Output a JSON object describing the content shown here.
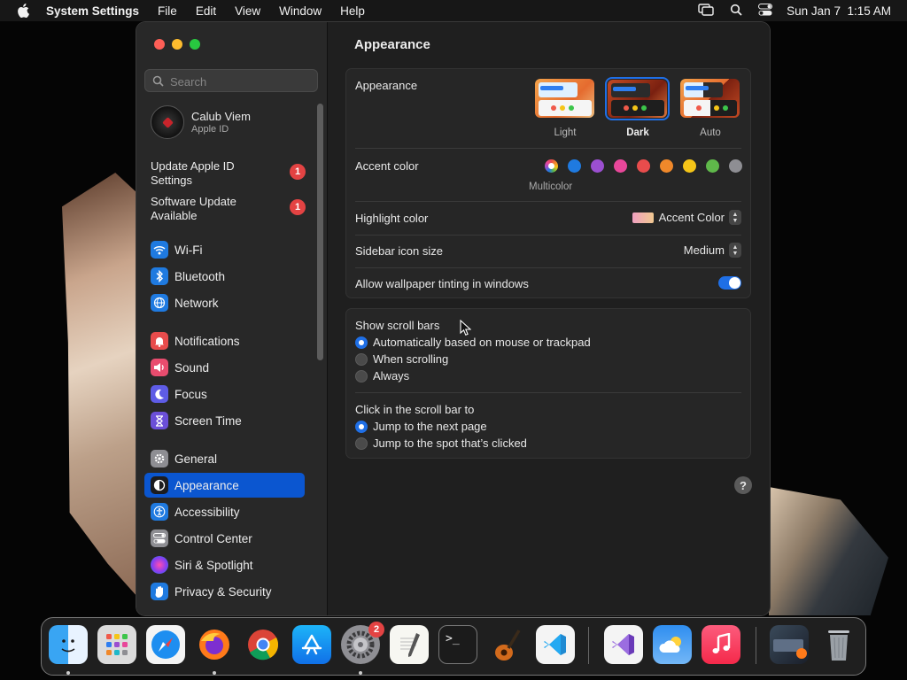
{
  "menubar": {
    "app_name": "System Settings",
    "menus": [
      "File",
      "Edit",
      "View",
      "Window",
      "Help"
    ],
    "datetime": "Sun Jan 7  1:15 AM"
  },
  "sidebar": {
    "search_placeholder": "Search",
    "account": {
      "name": "Calub Viem",
      "subtitle": "Apple ID"
    },
    "notices": [
      {
        "label_line1": "Update Apple ID",
        "label_line2": "Settings",
        "badge": "1"
      },
      {
        "label_line1": "Software Update",
        "label_line2": "Available",
        "badge": "1"
      }
    ],
    "items": [
      {
        "label": "Wi-Fi",
        "icon": "wifi-icon",
        "color": "#1f7ae0"
      },
      {
        "label": "Bluetooth",
        "icon": "bluetooth-icon",
        "color": "#1f7ae0"
      },
      {
        "label": "Network",
        "icon": "globe-icon",
        "color": "#1f7ae0"
      },
      {
        "label": "Notifications",
        "icon": "bell-icon",
        "color": "#e84c4c"
      },
      {
        "label": "Sound",
        "icon": "speaker-icon",
        "color": "#e84c6e"
      },
      {
        "label": "Focus",
        "icon": "moon-icon",
        "color": "#5e5ce6"
      },
      {
        "label": "Screen Time",
        "icon": "hourglass-icon",
        "color": "#6b4fd8"
      },
      {
        "label": "General",
        "icon": "gear-icon",
        "color": "#8e8e93"
      },
      {
        "label": "Appearance",
        "icon": "appearance-icon",
        "color": "#1c1c1e",
        "selected": true
      },
      {
        "label": "Accessibility",
        "icon": "accessibility-icon",
        "color": "#1f7ae0"
      },
      {
        "label": "Control Center",
        "icon": "control-center-icon",
        "color": "#8e8e93"
      },
      {
        "label": "Siri & Spotlight",
        "icon": "siri-icon",
        "color": "#b44ad8"
      },
      {
        "label": "Privacy & Security",
        "icon": "hand-icon",
        "color": "#1f7ae0"
      }
    ]
  },
  "main": {
    "title": "Appearance",
    "appearance": {
      "label": "Appearance",
      "options": [
        {
          "label": "Light",
          "selected": false
        },
        {
          "label": "Dark",
          "selected": true
        },
        {
          "label": "Auto",
          "selected": false
        }
      ]
    },
    "accent": {
      "label": "Accent color",
      "caption": "Multicolor",
      "colors": [
        "multicolor",
        "#1f7ae0",
        "#9b4fd0",
        "#e8479a",
        "#e84c4c",
        "#f0882a",
        "#f5c518",
        "#5fb84a",
        "#8e8e93"
      ]
    },
    "highlight": {
      "label": "Highlight color",
      "value": "Accent Color"
    },
    "sidebar_icon_size": {
      "label": "Sidebar icon size",
      "value": "Medium"
    },
    "wallpaper_tinting": {
      "label": "Allow wallpaper tinting in windows",
      "enabled": true
    },
    "scroll_bars": {
      "label": "Show scroll bars",
      "options": [
        {
          "label": "Automatically based on mouse or trackpad",
          "checked": true
        },
        {
          "label": "When scrolling",
          "checked": false
        },
        {
          "label": "Always",
          "checked": false
        }
      ]
    },
    "click_scroll": {
      "label": "Click in the scroll bar to",
      "options": [
        {
          "label": "Jump to the next page",
          "checked": true
        },
        {
          "label": "Jump to the spot that’s clicked",
          "checked": false
        }
      ]
    },
    "help": "?"
  },
  "dock": {
    "apps": [
      {
        "name": "Finder",
        "icon": "finder-icon",
        "running": true
      },
      {
        "name": "Launchpad",
        "icon": "launchpad-icon",
        "running": false
      },
      {
        "name": "Safari",
        "icon": "safari-icon",
        "running": false
      },
      {
        "name": "Firefox",
        "icon": "firefox-icon",
        "running": true
      },
      {
        "name": "Chrome",
        "icon": "chrome-icon",
        "running": false
      },
      {
        "name": "App Store",
        "icon": "app-store-icon",
        "running": false
      },
      {
        "name": "System Settings",
        "icon": "system-settings-icon",
        "running": true,
        "badge": "2"
      },
      {
        "name": "TextEdit",
        "icon": "textedit-icon",
        "running": false
      },
      {
        "name": "Terminal",
        "icon": "terminal-icon",
        "running": false
      },
      {
        "name": "GarageBand",
        "icon": "garageband-icon",
        "running": false
      },
      {
        "name": "VS Code",
        "icon": "vscode-icon",
        "running": false
      },
      {
        "name": "Visual Studio",
        "icon": "visual-studio-icon",
        "running": false
      },
      {
        "name": "Weather",
        "icon": "weather-icon",
        "running": false
      },
      {
        "name": "Music",
        "icon": "music-icon",
        "running": false
      },
      {
        "name": "Downloads",
        "icon": "downloads-stack-icon",
        "running": false
      },
      {
        "name": "Trash",
        "icon": "trash-icon",
        "running": false
      }
    ]
  }
}
